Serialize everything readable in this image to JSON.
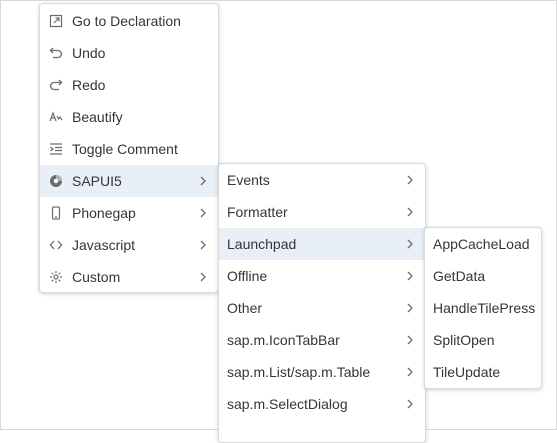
{
  "context_menu": {
    "items": [
      {
        "label": "Go to Declaration",
        "icon": "go-to-declaration-icon"
      },
      {
        "label": "Undo",
        "icon": "undo-icon"
      },
      {
        "label": "Redo",
        "icon": "redo-icon"
      },
      {
        "label": "Beautify",
        "icon": "beautify-icon"
      },
      {
        "label": "Toggle Comment",
        "icon": "toggle-comment-icon"
      },
      {
        "label": "SAPUI5",
        "icon": "sapui5-icon"
      },
      {
        "label": "Phonegap",
        "icon": "phone-icon"
      },
      {
        "label": "Javascript",
        "icon": "code-icon"
      },
      {
        "label": "Custom",
        "icon": "gear-icon"
      }
    ]
  },
  "sapui5_submenu": {
    "items": [
      {
        "label": "Events"
      },
      {
        "label": "Formatter"
      },
      {
        "label": "Launchpad"
      },
      {
        "label": "Offline"
      },
      {
        "label": "Other"
      },
      {
        "label": "sap.m.IconTabBar"
      },
      {
        "label": "sap.m.List/sap.m.Table"
      },
      {
        "label": "sap.m.SelectDialog"
      }
    ]
  },
  "launchpad_submenu": {
    "items": [
      {
        "label": "AppCacheLoad"
      },
      {
        "label": "GetData"
      },
      {
        "label": "HandleTilePress"
      },
      {
        "label": "SplitOpen"
      },
      {
        "label": "TileUpdate"
      }
    ]
  },
  "colors": {
    "highlight": "#e8eff6",
    "text": "#32363a",
    "icon": "#6a6d70",
    "border": "#d9d9d9"
  }
}
